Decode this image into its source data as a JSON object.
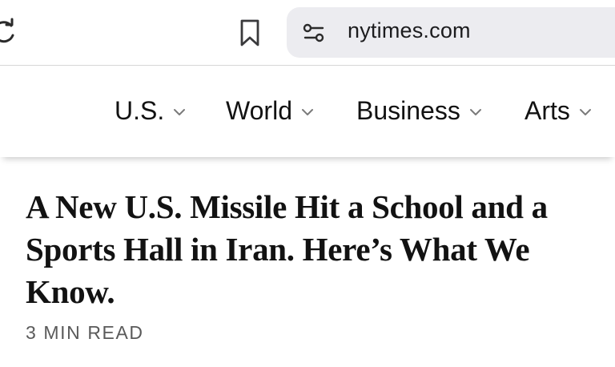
{
  "browser": {
    "url": "nytimes.com",
    "icons": {
      "reload": "reload-icon",
      "bookmark": "bookmark-icon",
      "site_settings": "site-settings-icon"
    }
  },
  "nav": {
    "items": [
      {
        "label": "U.S."
      },
      {
        "label": "World"
      },
      {
        "label": "Business"
      },
      {
        "label": "Arts"
      }
    ],
    "chevron_icon": "chevron-down-icon"
  },
  "article": {
    "headline": "A New U.S. Missile Hit a School and a Sports Hall in Iran. Here’s What We Know.",
    "read_time": "3 MIN READ"
  },
  "colors": {
    "text": "#121212",
    "muted": "#5a5a5a",
    "address_bar": "#ececf0"
  }
}
